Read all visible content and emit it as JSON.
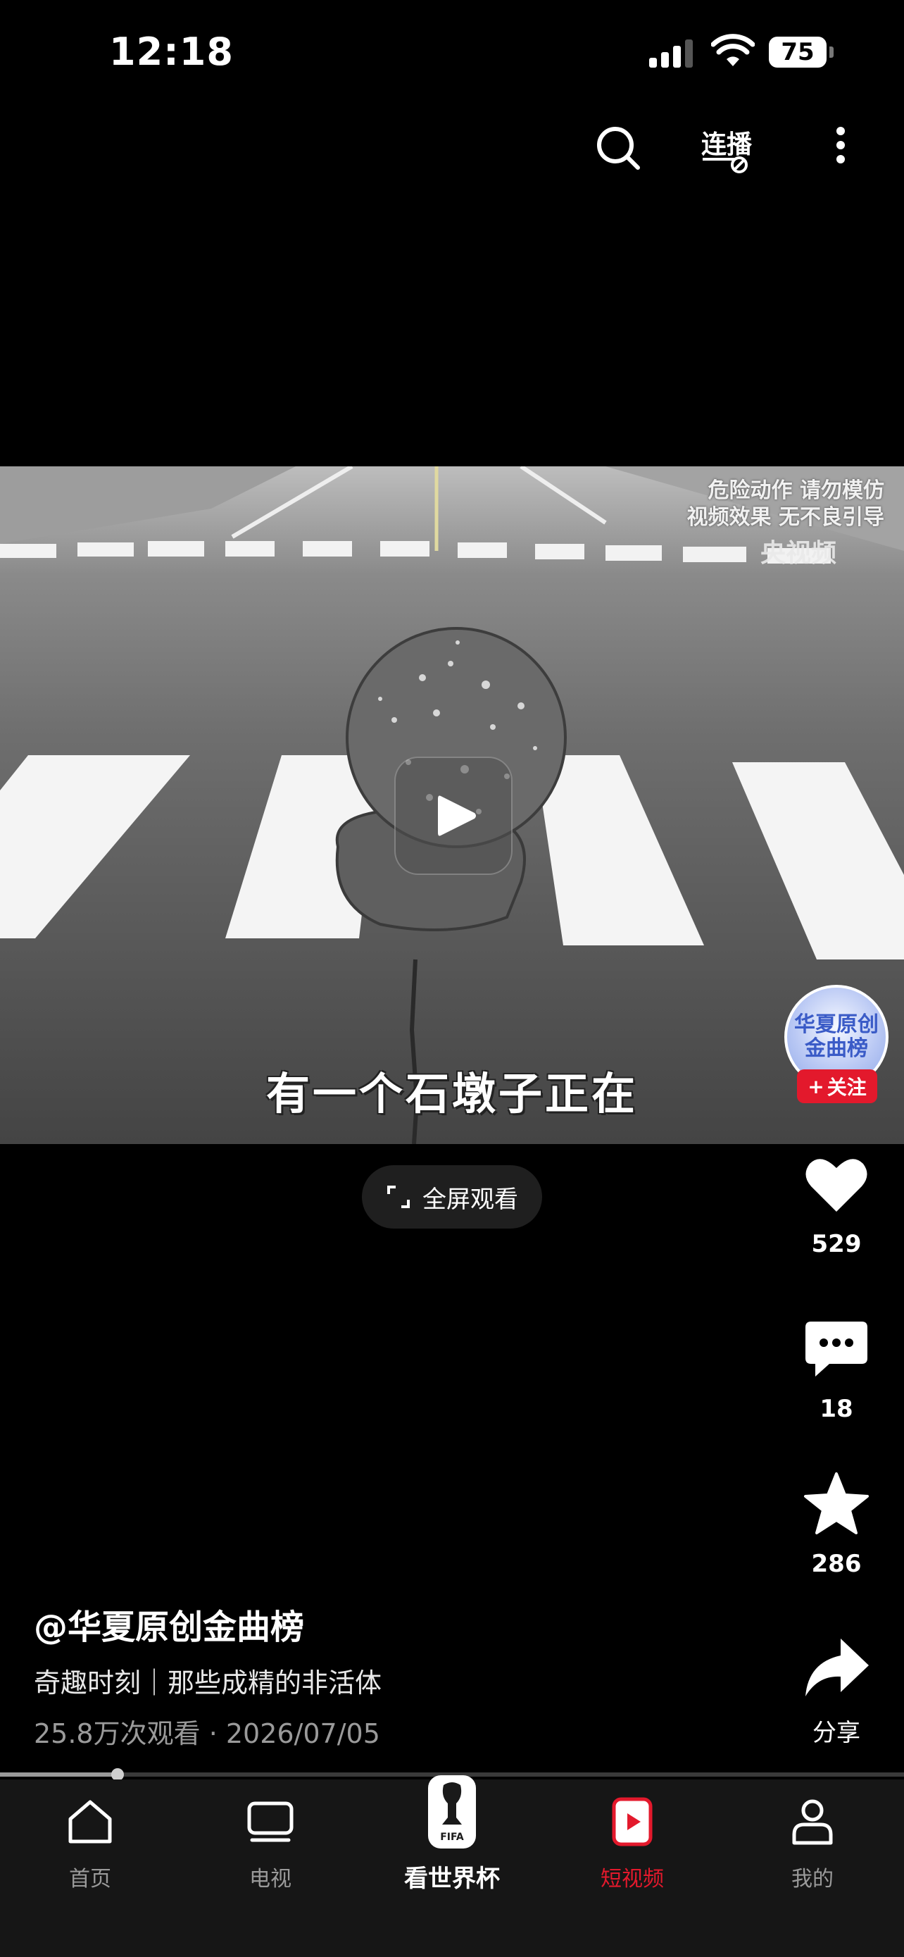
{
  "status": {
    "time": "12:18",
    "battery": "75"
  },
  "top_bar": {
    "lianbo_label": "连播"
  },
  "video": {
    "watermark_line1": "危险动作 请勿模仿",
    "watermark_line2": "视频效果 无不良引导",
    "logo": "央视频",
    "subtitle": "有一个石墩子正在"
  },
  "fullscreen": {
    "label": "全屏观看"
  },
  "creator": {
    "avatar_line1": "华夏原创",
    "avatar_line2": "金曲榜",
    "follow_label": "关注"
  },
  "actions": {
    "likes": "529",
    "comments": "18",
    "favorites": "286",
    "share_label": "分享"
  },
  "info": {
    "author": "@华夏原创金曲榜",
    "title": "奇趣时刻｜那些成精的非活体",
    "meta": "25.8万次观看 · 2026/07/05"
  },
  "progress": {
    "fraction": 0.13
  },
  "nav": {
    "home": "首页",
    "tv": "电视",
    "worldcup": "看世界杯",
    "short_video": "短视频",
    "mine": "我的"
  },
  "colors": {
    "accent_red": "#e3192c",
    "background": "#000000"
  }
}
